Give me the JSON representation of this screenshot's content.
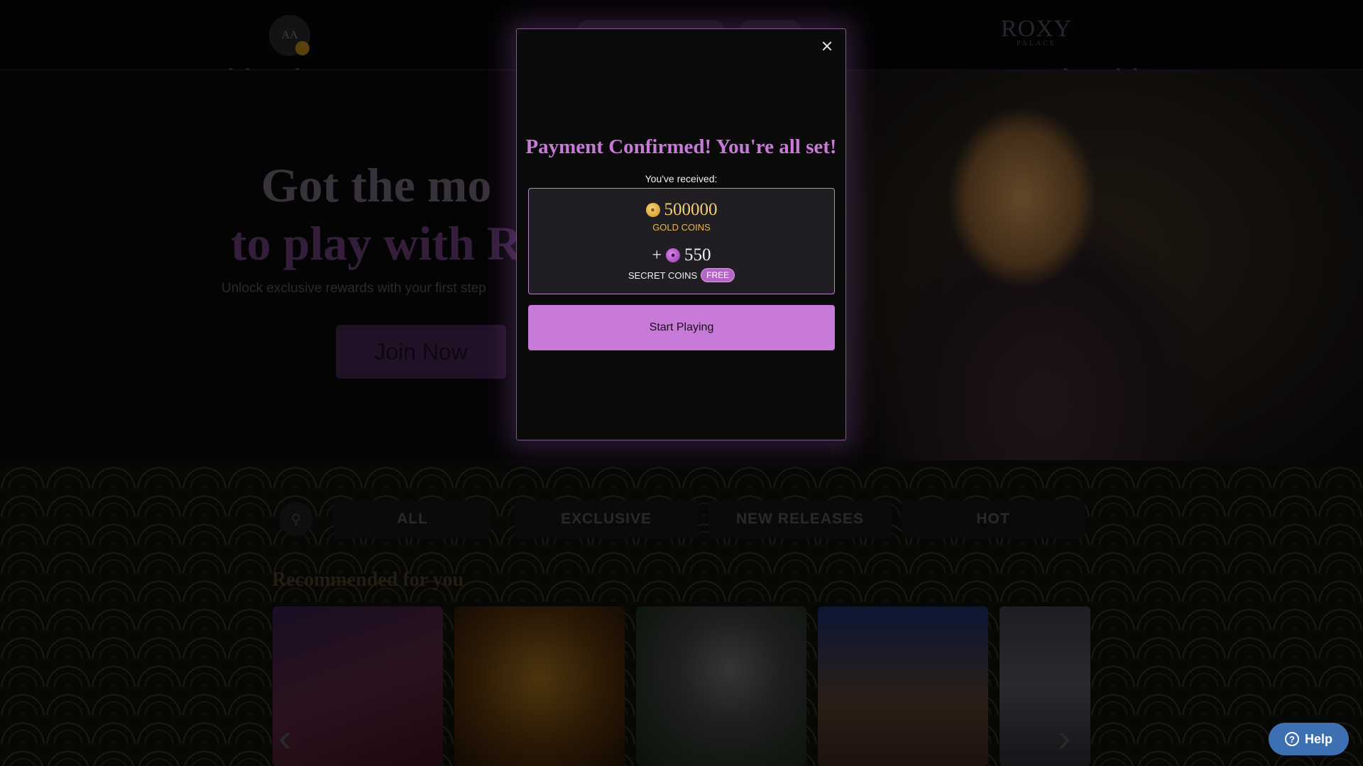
{
  "header": {
    "avatar_initials": "AA",
    "logo_text": "ROXY",
    "logo_subtext": "PALACE"
  },
  "hero": {
    "title_line1": "Got the mo",
    "title_line2": "to play with R",
    "subtitle": "Unlock exclusive rewards with your first step",
    "join_button": "Join Now"
  },
  "tabs": [
    {
      "label": "ALL"
    },
    {
      "label": "EXCLUSIVE"
    },
    {
      "label": "NEW RELEASES"
    },
    {
      "label": "HOT"
    }
  ],
  "section": {
    "recommended_title": "Recommended for you"
  },
  "modal": {
    "title": "Payment Confirmed! You're all set!",
    "received_label": "You've received:",
    "gold_amount": "500000",
    "gold_label": "GOLD COINS",
    "plus": "+",
    "secret_amount": "550",
    "secret_label": "SECRET COINS",
    "free_badge": "FREE",
    "start_button": "Start Playing"
  },
  "help": {
    "label": "Help"
  },
  "icons": {
    "close": "close-icon",
    "gold_coin": "gold-coin-icon",
    "secret_coin": "secret-coin-icon",
    "search": "search-icon",
    "help": "question-icon"
  },
  "colors": {
    "accent": "#c87ad9",
    "gold": "#f2cd7a",
    "help_blue": "#3d6fb3"
  }
}
